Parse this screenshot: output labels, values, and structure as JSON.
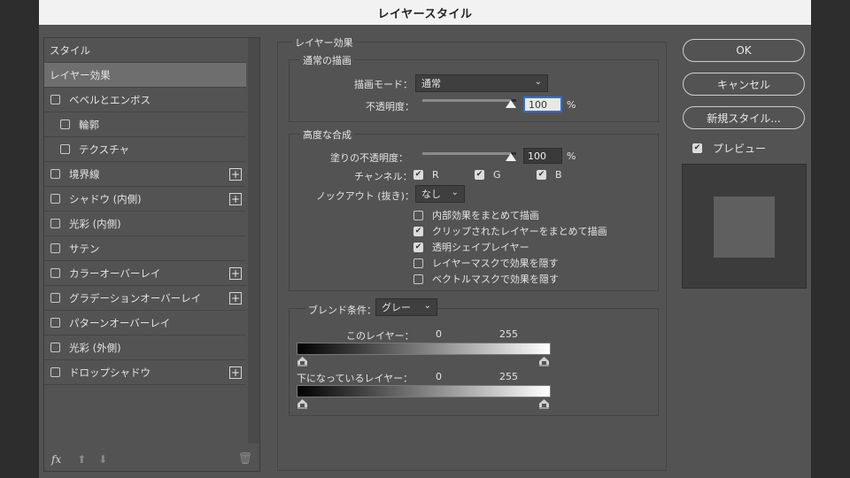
{
  "dialog": {
    "title": "レイヤースタイル"
  },
  "styles": {
    "header": "スタイル",
    "selected": "レイヤー効果",
    "items": [
      {
        "label": "ベベルとエンボス",
        "checked": false,
        "plus": false,
        "indent": false
      },
      {
        "label": "輪郭",
        "checked": false,
        "plus": false,
        "indent": true
      },
      {
        "label": "テクスチャ",
        "checked": false,
        "plus": false,
        "indent": true
      },
      {
        "label": "境界線",
        "checked": false,
        "plus": true,
        "indent": false
      },
      {
        "label": "シャドウ (内側)",
        "checked": false,
        "plus": true,
        "indent": false
      },
      {
        "label": "光彩 (内側)",
        "checked": false,
        "plus": false,
        "indent": false
      },
      {
        "label": "サテン",
        "checked": false,
        "plus": false,
        "indent": false
      },
      {
        "label": "カラーオーバーレイ",
        "checked": false,
        "plus": true,
        "indent": false
      },
      {
        "label": "グラデーションオーバーレイ",
        "checked": false,
        "plus": true,
        "indent": false
      },
      {
        "label": "パターンオーバーレイ",
        "checked": false,
        "plus": false,
        "indent": false
      },
      {
        "label": "光彩 (外側)",
        "checked": false,
        "plus": false,
        "indent": false
      },
      {
        "label": "ドロップシャドウ",
        "checked": false,
        "plus": true,
        "indent": false
      }
    ],
    "footer": {
      "fx": "fx",
      "up_icon": "arrow-up-icon",
      "down_icon": "arrow-down-icon",
      "trash_icon": "trash-icon"
    }
  },
  "effects": {
    "title": "レイヤー効果",
    "normal_blending": {
      "title": "通常の描画",
      "mode_label": "描画モード：",
      "mode_value": "通常",
      "opacity_label": "不透明度：",
      "opacity_value": "100",
      "percent": "%"
    },
    "advanced_blending": {
      "title": "高度な合成",
      "fill_opacity_label": "塗りの不透明度：",
      "fill_opacity_value": "100",
      "percent": "%",
      "channels_label": "チャンネル：",
      "channels": [
        {
          "label": "R",
          "checked": true
        },
        {
          "label": "G",
          "checked": true
        },
        {
          "label": "B",
          "checked": true
        }
      ],
      "knockout_label": "ノックアウト (抜き)：",
      "knockout_value": "なし",
      "options": [
        {
          "label": "内部効果をまとめて描画",
          "checked": false
        },
        {
          "label": "クリップされたレイヤーをまとめて描画",
          "checked": true
        },
        {
          "label": "透明シェイプレイヤー",
          "checked": true
        },
        {
          "label": "レイヤーマスクで効果を隠す",
          "checked": false
        },
        {
          "label": "ベクトルマスクで効果を隠す",
          "checked": false
        }
      ]
    },
    "blend_if": {
      "label": "ブレンド条件：",
      "value": "グレー",
      "this_layer_label": "このレイヤー：",
      "this_layer_min": "0",
      "this_layer_max": "255",
      "underlying_label": "下になっているレイヤー：",
      "underlying_min": "0",
      "underlying_max": "255"
    }
  },
  "buttons": {
    "ok": "OK",
    "cancel": "キャンセル",
    "new_style": "新規スタイル..."
  },
  "preview": {
    "label": "プレビュー",
    "checked": true
  }
}
